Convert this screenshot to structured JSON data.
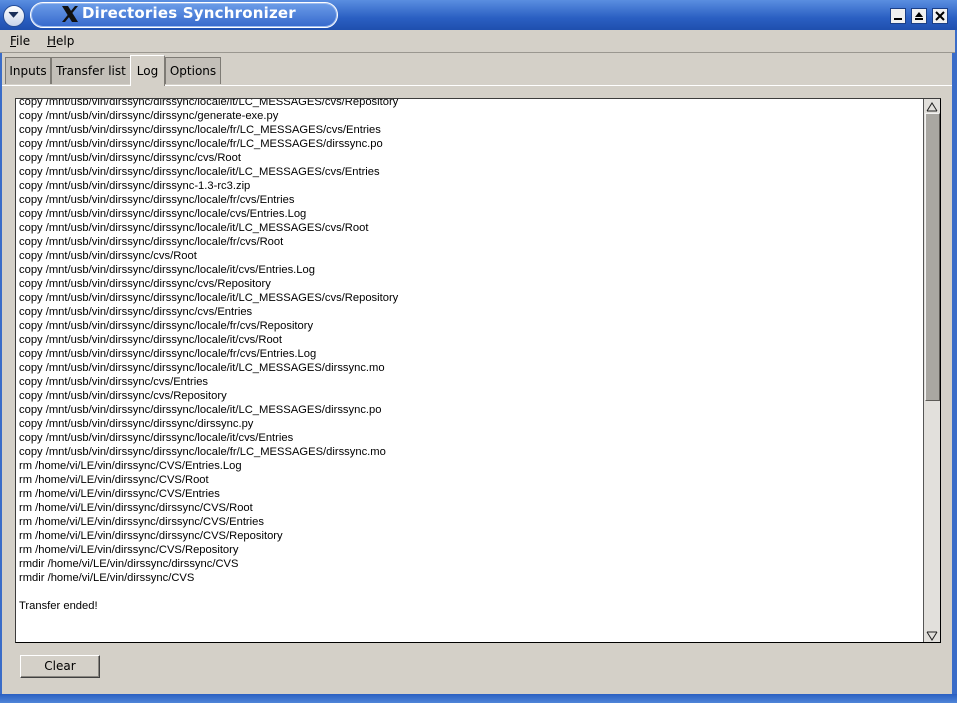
{
  "window": {
    "title": "Directories Synchronizer"
  },
  "menubar": {
    "items": [
      {
        "label": "File",
        "mnemonic": "F"
      },
      {
        "label": "Help",
        "mnemonic": "H"
      }
    ]
  },
  "tabs": [
    {
      "label": "Inputs",
      "active": false
    },
    {
      "label": "Transfer list",
      "active": false
    },
    {
      "label": "Log",
      "active": true
    },
    {
      "label": "Options",
      "active": false
    }
  ],
  "log": {
    "lines": [
      "copy /mnt/usb/vin/dirssync/dirssync/locale/it/LC_MESSAGES/cvs/Repository",
      "copy /mnt/usb/vin/dirssync/dirssync/generate-exe.py",
      "copy /mnt/usb/vin/dirssync/dirssync/locale/fr/LC_MESSAGES/cvs/Entries",
      "copy /mnt/usb/vin/dirssync/dirssync/locale/fr/LC_MESSAGES/dirssync.po",
      "copy /mnt/usb/vin/dirssync/dirssync/cvs/Root",
      "copy /mnt/usb/vin/dirssync/dirssync/locale/it/LC_MESSAGES/cvs/Entries",
      "copy /mnt/usb/vin/dirssync/dirssync-1.3-rc3.zip",
      "copy /mnt/usb/vin/dirssync/dirssync/locale/fr/cvs/Entries",
      "copy /mnt/usb/vin/dirssync/dirssync/locale/cvs/Entries.Log",
      "copy /mnt/usb/vin/dirssync/dirssync/locale/it/LC_MESSAGES/cvs/Root",
      "copy /mnt/usb/vin/dirssync/dirssync/locale/fr/cvs/Root",
      "copy /mnt/usb/vin/dirssync/cvs/Root",
      "copy /mnt/usb/vin/dirssync/dirssync/locale/it/cvs/Entries.Log",
      "copy /mnt/usb/vin/dirssync/dirssync/cvs/Repository",
      "copy /mnt/usb/vin/dirssync/dirssync/locale/it/LC_MESSAGES/cvs/Repository",
      "copy /mnt/usb/vin/dirssync/dirssync/cvs/Entries",
      "copy /mnt/usb/vin/dirssync/dirssync/locale/fr/cvs/Repository",
      "copy /mnt/usb/vin/dirssync/dirssync/locale/it/cvs/Root",
      "copy /mnt/usb/vin/dirssync/dirssync/locale/fr/cvs/Entries.Log",
      "copy /mnt/usb/vin/dirssync/dirssync/locale/it/LC_MESSAGES/dirssync.mo",
      "copy /mnt/usb/vin/dirssync/cvs/Entries",
      "copy /mnt/usb/vin/dirssync/cvs/Repository",
      "copy /mnt/usb/vin/dirssync/dirssync/locale/it/LC_MESSAGES/dirssync.po",
      "copy /mnt/usb/vin/dirssync/dirssync/dirssync.py",
      "copy /mnt/usb/vin/dirssync/dirssync/locale/it/cvs/Entries",
      "copy /mnt/usb/vin/dirssync/dirssync/locale/fr/LC_MESSAGES/dirssync.mo",
      "rm /home/vi/LE/vin/dirssync/CVS/Entries.Log",
      "rm /home/vi/LE/vin/dirssync/CVS/Root",
      "rm /home/vi/LE/vin/dirssync/CVS/Entries",
      "rm /home/vi/LE/vin/dirssync/dirssync/CVS/Root",
      "rm /home/vi/LE/vin/dirssync/dirssync/CVS/Entries",
      "rm /home/vi/LE/vin/dirssync/dirssync/CVS/Repository",
      "rm /home/vi/LE/vin/dirssync/CVS/Repository",
      "rmdir /home/vi/LE/vin/dirssync/dirssync/CVS",
      "rmdir /home/vi/LE/vin/dirssync/CVS",
      "",
      "Transfer ended!"
    ]
  },
  "buttons": {
    "clear": "Clear"
  },
  "colors": {
    "titlebar": "#2a5fc2",
    "window_bg": "#d4d0c8",
    "log_bg": "#ffffff"
  }
}
